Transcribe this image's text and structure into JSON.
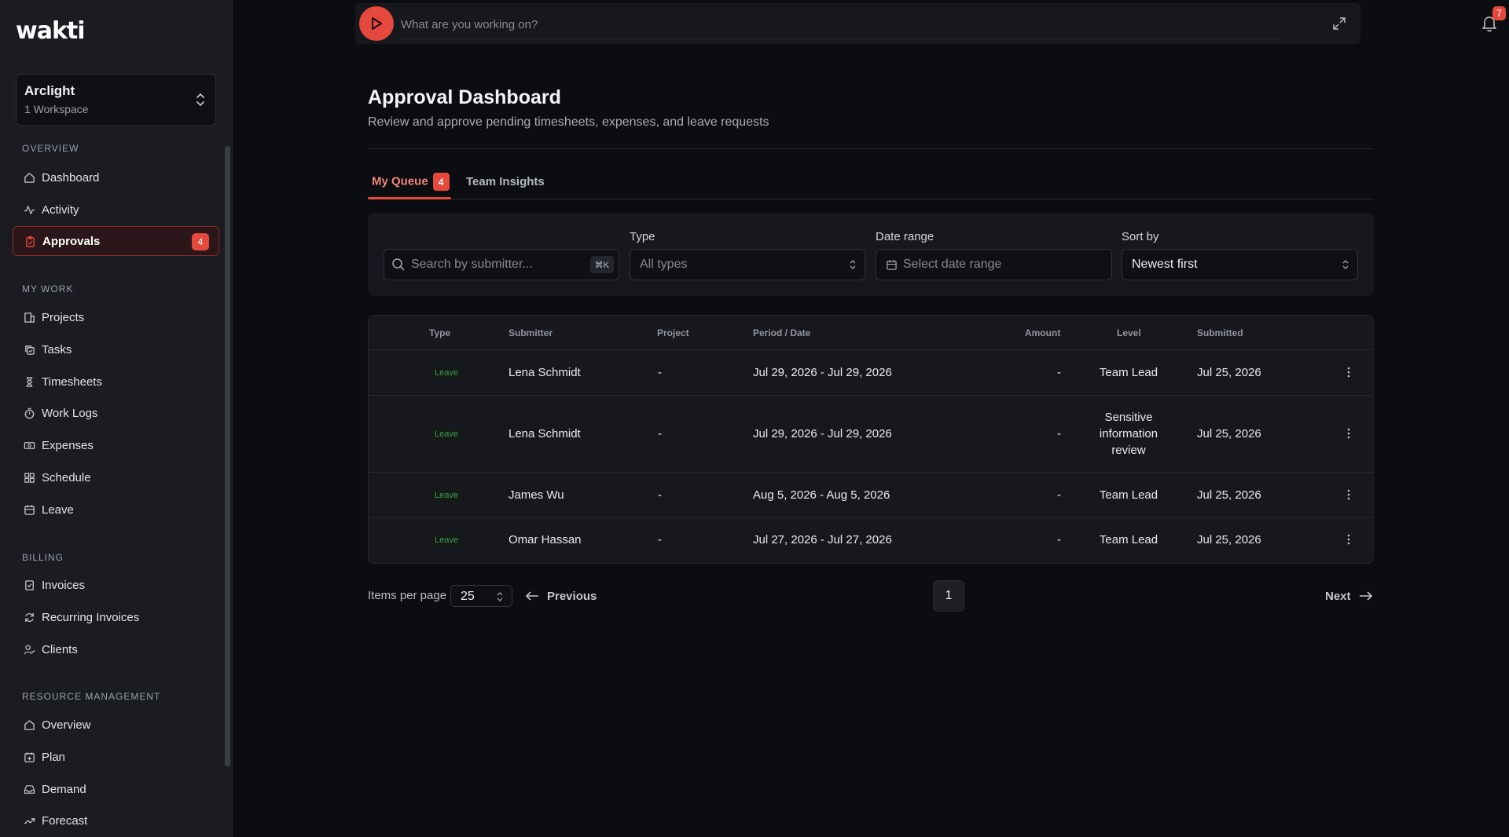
{
  "app": {
    "logo": "wakti"
  },
  "workspace": {
    "name": "Arclight",
    "count_label": "1 Workspace"
  },
  "sidebar": {
    "overview": {
      "title": "OVERVIEW",
      "items": [
        {
          "label": "Dashboard",
          "icon": "home-icon"
        },
        {
          "label": "Activity",
          "icon": "activity-icon"
        },
        {
          "label": "Approvals",
          "icon": "clipboard-check-icon",
          "badge": "4",
          "active": true
        }
      ]
    },
    "my_work": {
      "title": "MY WORK",
      "items": [
        {
          "label": "Projects",
          "icon": "building-icon"
        },
        {
          "label": "Tasks",
          "icon": "copy-check-icon"
        },
        {
          "label": "Timesheets",
          "icon": "hourglass-icon"
        },
        {
          "label": "Work Logs",
          "icon": "timer-icon"
        },
        {
          "label": "Expenses",
          "icon": "banknote-icon"
        },
        {
          "label": "Schedule",
          "icon": "grid-icon"
        },
        {
          "label": "Leave",
          "icon": "calendar-icon"
        }
      ]
    },
    "billing": {
      "title": "BILLING",
      "items": [
        {
          "label": "Invoices",
          "icon": "invoice-icon"
        },
        {
          "label": "Recurring Invoices",
          "icon": "refresh-icon"
        },
        {
          "label": "Clients",
          "icon": "users-icon"
        }
      ]
    },
    "resource_management": {
      "title": "RESOURCE MANAGEMENT",
      "items": [
        {
          "label": "Overview",
          "icon": "home-icon"
        },
        {
          "label": "Plan",
          "icon": "calendar-plus-icon"
        },
        {
          "label": "Demand",
          "icon": "inbox-icon"
        },
        {
          "label": "Forecast",
          "icon": "trending-up-icon"
        }
      ]
    }
  },
  "timer": {
    "placeholder": "What are you working on?"
  },
  "notifications": {
    "count": "7"
  },
  "page": {
    "title": "Approval Dashboard",
    "subtitle": "Review and approve pending timesheets, expenses, and leave requests"
  },
  "tabs": [
    {
      "label": "My Queue",
      "badge": "4",
      "active": true
    },
    {
      "label": "Team Insights"
    }
  ],
  "filters": {
    "search_placeholder": "Search by submitter...",
    "search_shortcut": "⌘K",
    "type_label": "Type",
    "type_value": "All types",
    "date_label": "Date range",
    "date_placeholder": "Select date range",
    "sort_label": "Sort by",
    "sort_value": "Newest first"
  },
  "table": {
    "headers": [
      "Type",
      "Submitter",
      "Project",
      "Period / Date",
      "Amount",
      "Level",
      "Submitted"
    ],
    "rows": [
      {
        "type": "Leave",
        "submitter": "Lena Schmidt",
        "project": "-",
        "period": "Jul 29, 2026 - Jul 29, 2026",
        "amount": "-",
        "level": "Team Lead",
        "submitted": "Jul 25, 2026"
      },
      {
        "type": "Leave",
        "submitter": "Lena Schmidt",
        "project": "-",
        "period": "Jul 29, 2026 - Jul 29, 2026",
        "amount": "-",
        "level": "Sensitive information review",
        "submitted": "Jul 25, 2026"
      },
      {
        "type": "Leave",
        "submitter": "James Wu",
        "project": "-",
        "period": "Aug 5, 2026 - Aug 5, 2026",
        "amount": "-",
        "level": "Team Lead",
        "submitted": "Jul 25, 2026"
      },
      {
        "type": "Leave",
        "submitter": "Omar Hassan",
        "project": "-",
        "period": "Jul 27, 2026 - Jul 27, 2026",
        "amount": "-",
        "level": "Team Lead",
        "submitted": "Jul 25, 2026"
      }
    ]
  },
  "pagination": {
    "items_per_page_label": "Items per page",
    "items_per_page": "25",
    "previous": "Previous",
    "current_page": "1",
    "next": "Next"
  },
  "colors": {
    "accent": "#e5483c",
    "background": "#0c0d11",
    "sidebar": "#1a1c22",
    "leave_badge": "#3f9a55"
  }
}
